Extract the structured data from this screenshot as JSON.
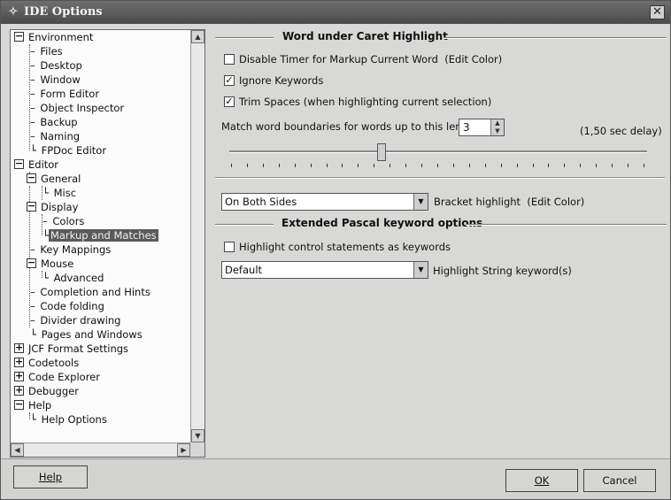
{
  "window": {
    "title": "IDE Options",
    "app_icon": "lazarus-icon",
    "close_glyph": "✕"
  },
  "tree": {
    "items": [
      {
        "label": "Environment"
      },
      {
        "label": "Files"
      },
      {
        "label": "Desktop"
      },
      {
        "label": "Window"
      },
      {
        "label": "Form Editor"
      },
      {
        "label": "Object Inspector"
      },
      {
        "label": "Backup"
      },
      {
        "label": "Naming"
      },
      {
        "label": "FPDoc Editor"
      },
      {
        "label": "Editor"
      },
      {
        "label": "General"
      },
      {
        "label": "Misc"
      },
      {
        "label": "Display"
      },
      {
        "label": "Colors"
      },
      {
        "label": "Markup and Matches"
      },
      {
        "label": "Key Mappings"
      },
      {
        "label": "Mouse"
      },
      {
        "label": "Advanced"
      },
      {
        "label": "Completion and Hints"
      },
      {
        "label": "Code folding"
      },
      {
        "label": "Divider drawing"
      },
      {
        "label": "Pages and Windows"
      },
      {
        "label": "JCF Format Settings"
      },
      {
        "label": "Codetools"
      },
      {
        "label": "Code Explorer"
      },
      {
        "label": "Debugger"
      },
      {
        "label": "Help"
      },
      {
        "label": "Help Options"
      }
    ],
    "selected": "Markup and Matches"
  },
  "word_caret": {
    "header": "Word under Caret Highlight",
    "disable_timer": {
      "label": "Disable Timer for Markup Current Word",
      "checked": false,
      "edit_color": "(Edit Color)"
    },
    "ignore_keywords": {
      "label": "Ignore Keywords",
      "checked": true
    },
    "trim_spaces": {
      "label": "Trim Spaces (when highlighting current selection)",
      "checked": true
    },
    "match_label": "Match word boundaries for words up to this length:",
    "match_value": "3",
    "delay_label": "(1,50 sec delay)",
    "slider_fraction": 0.37
  },
  "bracket": {
    "combo_value": "On Both Sides",
    "label": "Bracket highlight",
    "edit_color": "(Edit Color)"
  },
  "pascal": {
    "header": "Extended Pascal keyword options",
    "highlight_control": {
      "label": "Highlight control statements as keywords",
      "checked": false
    },
    "string_combo_value": "Default",
    "string_label": "Highlight String keyword(s)"
  },
  "buttons": {
    "help": "Help",
    "ok": "OK",
    "cancel": "Cancel"
  }
}
